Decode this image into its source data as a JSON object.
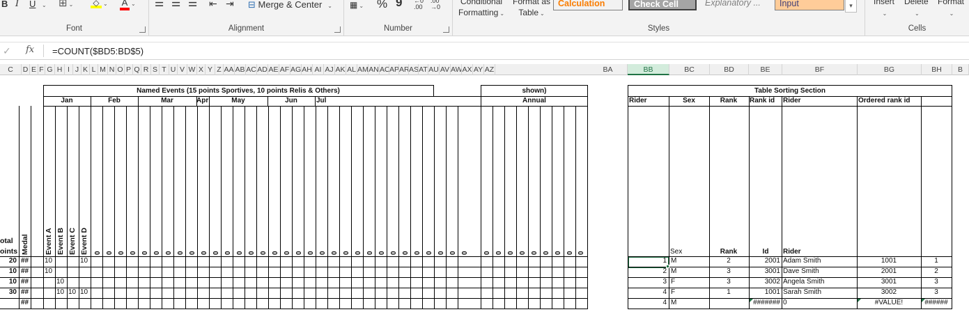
{
  "ribbon": {
    "font_label": "Font",
    "alignment_label": "Alignment",
    "number_label": "Number",
    "styles_label": "Styles",
    "cells_label": "Cells",
    "merge_center": "Merge & Center",
    "percent": "%",
    "comma": "9",
    "conditional_formatting": [
      "Conditional",
      "Formatting"
    ],
    "format_as_table": [
      "Format as",
      "Table"
    ],
    "style_calculation": "Calculation",
    "style_check_cell": "Check Cell",
    "style_explanatory": "Explanatory ...",
    "style_input": "Input",
    "cells_insert": "Insert",
    "cells_delete": "Delete",
    "cells_format": "Format",
    "font_bold": "B",
    "font_italic": "I",
    "font_underline": "U",
    "font_color_letter": "A",
    "colors": {
      "calculation_text": "#fa7d00",
      "check_cell_bg": "#a5a5a5",
      "input_bg": "#ffcc99",
      "fill_yellow": "#ffff00",
      "font_red": "#ff0000",
      "accent_green": "#217346"
    }
  },
  "formula_bar": {
    "formula": "=COUNT($BD5:BD$5)",
    "fx": "fx"
  },
  "columns": {
    "left": [
      "C",
      "D",
      "E",
      "F",
      "G",
      "H",
      "I",
      "J",
      "K",
      "L",
      "M",
      "N",
      "O",
      "P",
      "Q",
      "R",
      "S",
      "T",
      "U",
      "V",
      "W",
      "X",
      "Y",
      "Z",
      "AA",
      "AB",
      "AC",
      "AD",
      "AE",
      "AF",
      "AG",
      "AH",
      "AI",
      "AJ",
      "AK",
      "AL",
      "AM",
      "AN",
      "AO",
      "AP",
      "AR",
      "AS",
      "AT",
      "AU",
      "AV",
      "AW",
      "AX",
      "AY",
      "AZ"
    ],
    "right": [
      "BA",
      "BB",
      "BC",
      "BD",
      "BE",
      "BF",
      "BG",
      "BH",
      "B"
    ],
    "selected": "BB"
  },
  "sheet": {
    "named_events_title": "Named Events (15 points Sportives, 10 points Relis & Others)",
    "shown_title": "shown)",
    "annual": "Annual",
    "months": [
      "Jan",
      "Feb",
      "Mar",
      "Apr",
      "May",
      "Jun",
      "Jul"
    ],
    "total_points": [
      "otal",
      "oints"
    ],
    "medal": "Medal",
    "events": [
      "Event A",
      "Event B",
      "Event C",
      "Event D"
    ],
    "zero": "0",
    "totals": [
      "20",
      "10",
      "10",
      "30",
      ""
    ],
    "medals": [
      "##",
      "##",
      "##",
      "##",
      "##"
    ],
    "event_values": [
      [
        "10",
        "",
        "",
        "10"
      ],
      [
        "10",
        "",
        "",
        ""
      ],
      [
        "",
        "10",
        "",
        ""
      ],
      [
        "",
        "10",
        "10",
        "10"
      ],
      [
        "",
        "",
        "",
        ""
      ]
    ],
    "table_sorting_title": "Table Sorting Section",
    "sort_headers": [
      "Rider",
      "Sex",
      "Rank",
      "Rank id",
      "Rider",
      "Ordered rank  id"
    ],
    "sub_headers": [
      "Sex",
      "Rank",
      "Id",
      "Rider"
    ],
    "sort_rows": [
      {
        "rider": "1",
        "sex": "M",
        "rank": "2",
        "id": "2001",
        "name": "Adam Smith",
        "ordered": "1001",
        "bh": "1"
      },
      {
        "rider": "2",
        "sex": "M",
        "rank": "3",
        "id": "3001",
        "name": "Dave Smith",
        "ordered": "2001",
        "bh": "2"
      },
      {
        "rider": "3",
        "sex": "F",
        "rank": "3",
        "id": "3002",
        "name": "Angela Smith",
        "ordered": "3001",
        "bh": "3"
      },
      {
        "rider": "4",
        "sex": "F",
        "rank": "1",
        "id": "1001",
        "name": "Sarah Smith",
        "ordered": "3002",
        "bh": "3"
      },
      {
        "rider": "4",
        "sex": "M",
        "rank": "",
        "id": "#######",
        "name": "0",
        "ordered": "#VALUE!",
        "bh": "######"
      }
    ]
  }
}
